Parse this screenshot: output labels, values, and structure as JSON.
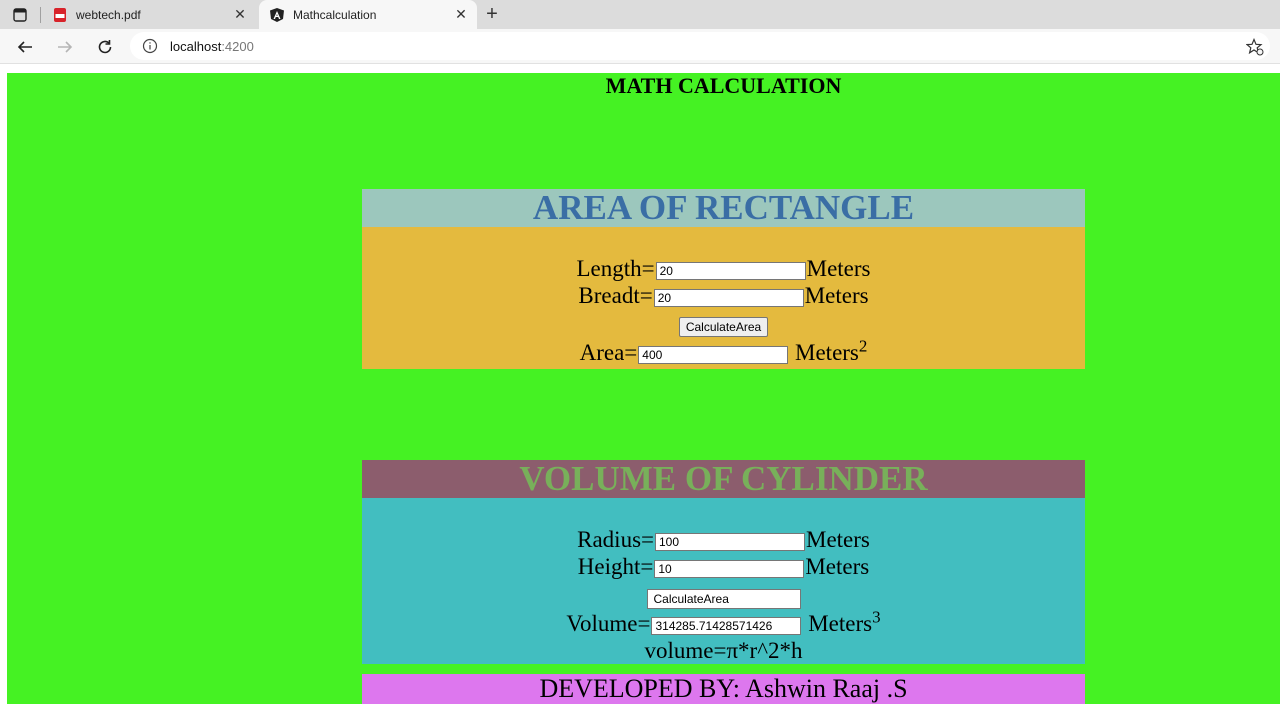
{
  "browser": {
    "tabs": [
      {
        "title": "webtech.pdf",
        "icon": "pdf-icon",
        "active": false
      },
      {
        "title": "Mathcalculation",
        "icon": "angular-icon",
        "active": true
      }
    ],
    "address": {
      "host": "localhost",
      "port": ":4200"
    }
  },
  "page": {
    "title": "MATH CALCULATION",
    "rectangle": {
      "heading": "AREA OF RECTANGLE",
      "length_label": "Length=",
      "length_value": "20",
      "breadth_label": "Breadt=",
      "breadth_value": "20",
      "unit": "Meters",
      "button_label": "CalculateArea",
      "area_label": "Area=",
      "area_value": "400",
      "area_unit": "Meters",
      "area_exp": "2"
    },
    "cylinder": {
      "heading": "VOLUME OF CYLINDER",
      "radius_label": "Radius=",
      "radius_value": "100",
      "height_label": "Height=",
      "height_value": "10",
      "unit": "Meters",
      "button_label": "CalculateArea",
      "volume_label": "Volume=",
      "volume_value": "314285.71428571426",
      "volume_unit": "Meters",
      "volume_exp": "3",
      "formula": "volume=π*r^2*h"
    },
    "footer": "DEVELOPED BY: Ashwin Raaj .S"
  },
  "colors": {
    "page_bg": "#45f223",
    "rect_head_bg": "#9cc7bd",
    "rect_head_text": "#3a6ea5",
    "rect_body_bg": "#e4ba3e",
    "cyl_head_bg": "#8c5d6d",
    "cyl_head_text": "#78b05a",
    "cyl_body_bg": "#42bec0",
    "footer_bg": "#dd77ee"
  }
}
